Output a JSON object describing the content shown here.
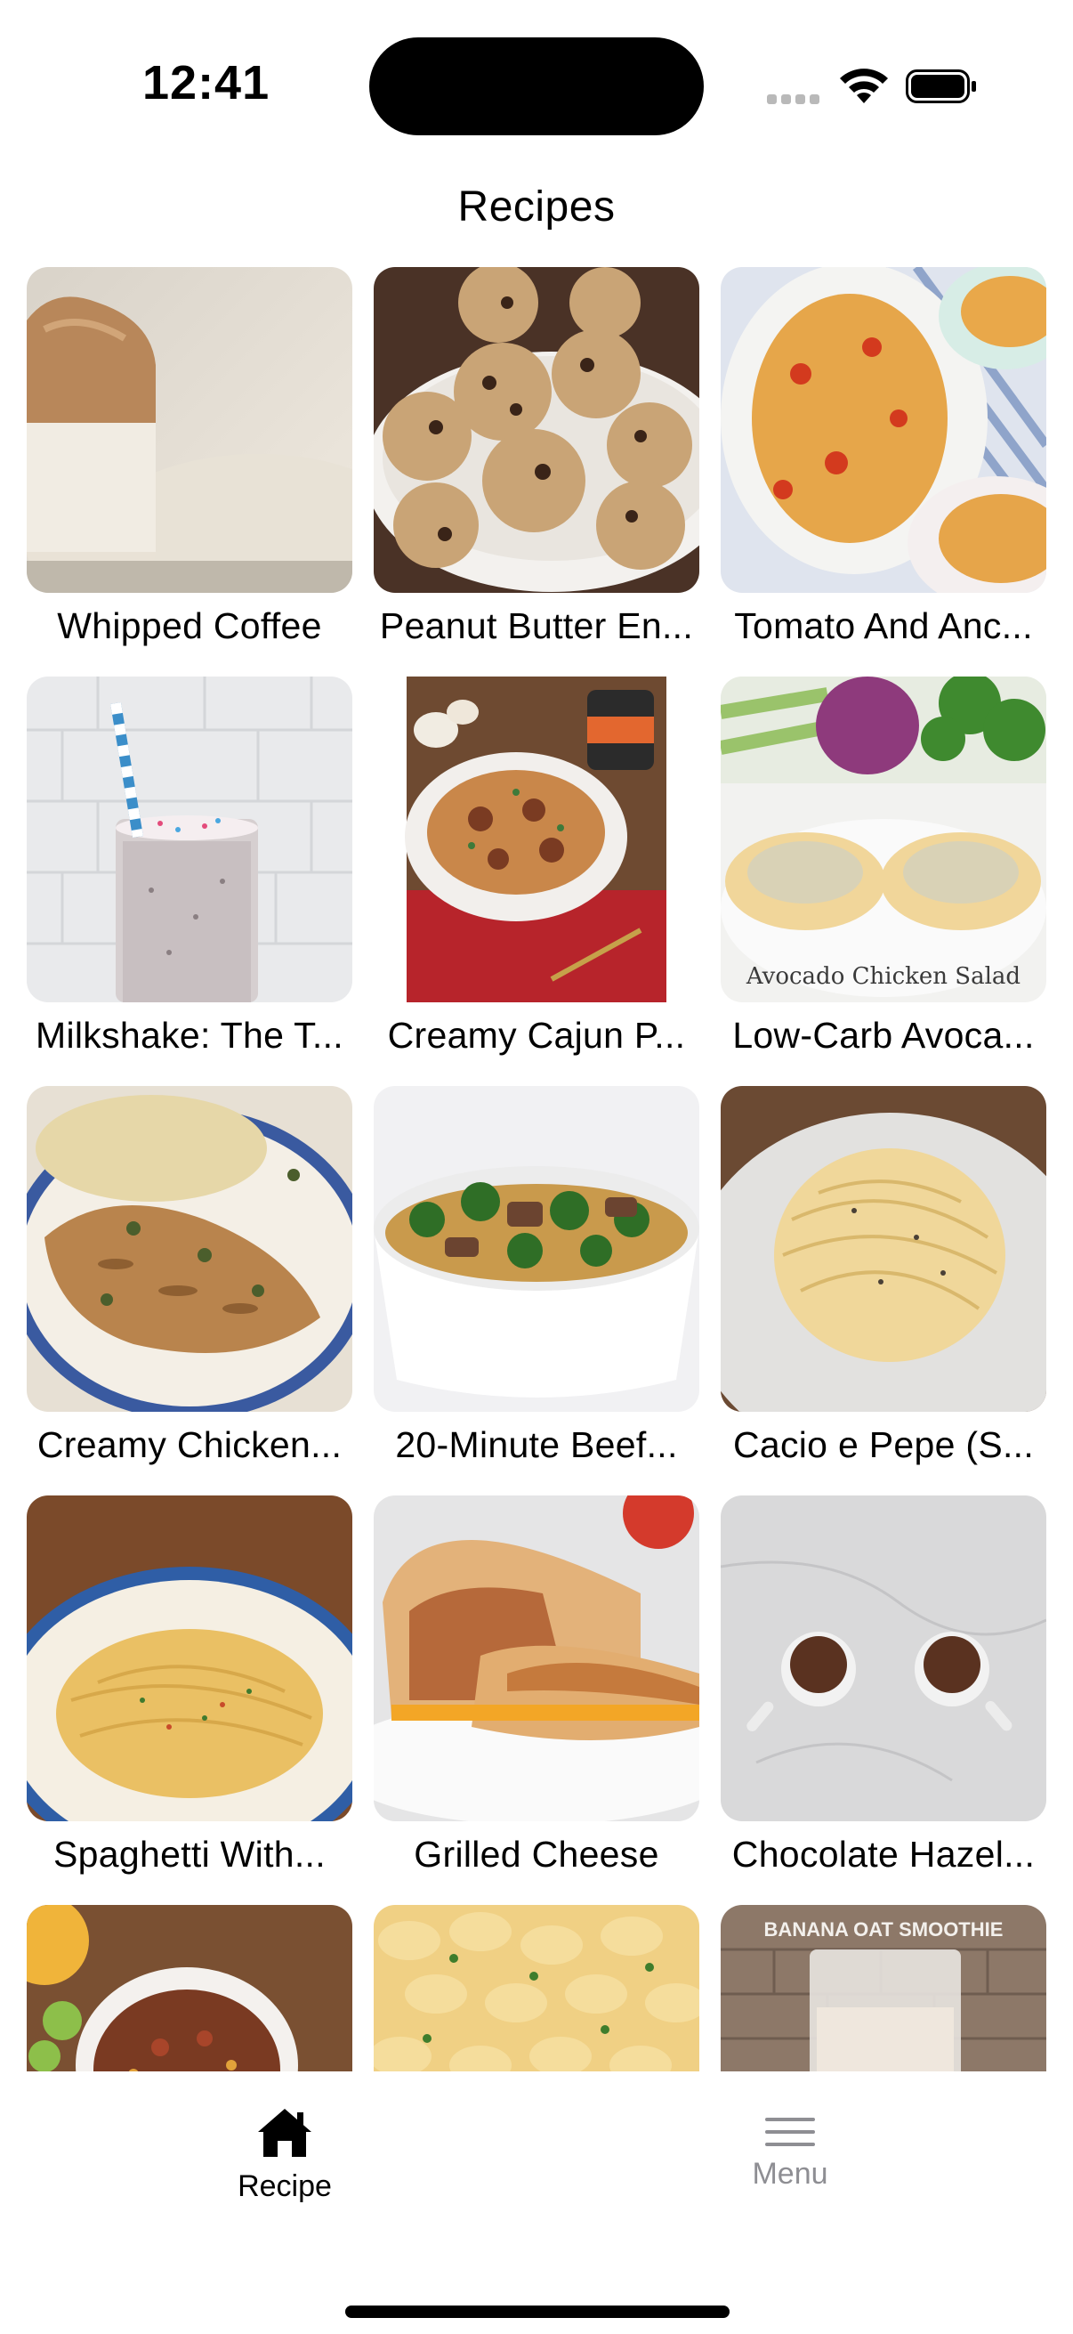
{
  "status_bar": {
    "time": "12:41"
  },
  "page_title": "Recipes",
  "recipes": [
    {
      "title": "Whipped Coffee"
    },
    {
      "title": "Peanut Butter En..."
    },
    {
      "title": "Tomato And Anc..."
    },
    {
      "title": "Milkshake: The T..."
    },
    {
      "title": "Creamy Cajun P..."
    },
    {
      "title": "Low-Carb Avoca..."
    },
    {
      "title": "Creamy Chicken..."
    },
    {
      "title": "20-Minute Beef..."
    },
    {
      "title": "Cacio e Pepe (S..."
    },
    {
      "title": "Spaghetti With..."
    },
    {
      "title": "Grilled Cheese"
    },
    {
      "title": "Chocolate Hazel..."
    },
    {
      "title": ""
    },
    {
      "title": ""
    },
    {
      "title": ""
    }
  ],
  "image_text": {
    "avocado_overlay": "Avocado Chicken Salad",
    "banana_overlay": "BANANA OAT SMOOTHIE"
  },
  "tabs": [
    {
      "label": "Recipe",
      "icon": "house-icon",
      "active": true
    },
    {
      "label": "Menu",
      "icon": "hamburger-icon",
      "active": false
    }
  ],
  "colors": {
    "active_tab": "#000000",
    "inactive_tab": "#8e8e93"
  }
}
